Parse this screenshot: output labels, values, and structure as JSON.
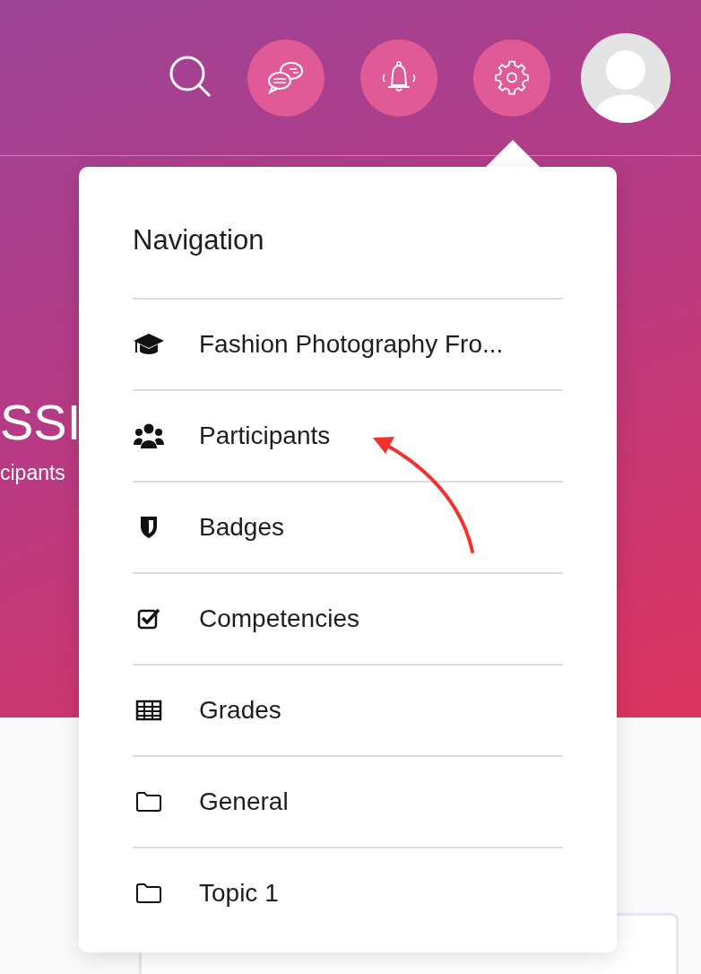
{
  "hero": {
    "title": "SSI",
    "subtitle": "cipants"
  },
  "navigation": {
    "title": "Navigation",
    "items": [
      {
        "label": "Fashion Photography Fro...",
        "kind": "course"
      },
      {
        "label": "Participants",
        "kind": "participants"
      },
      {
        "label": "Badges",
        "kind": "badges"
      },
      {
        "label": "Competencies",
        "kind": "competencies"
      },
      {
        "label": "Grades",
        "kind": "grades"
      },
      {
        "label": "General",
        "kind": "section"
      },
      {
        "label": "Topic 1",
        "kind": "section"
      }
    ]
  }
}
